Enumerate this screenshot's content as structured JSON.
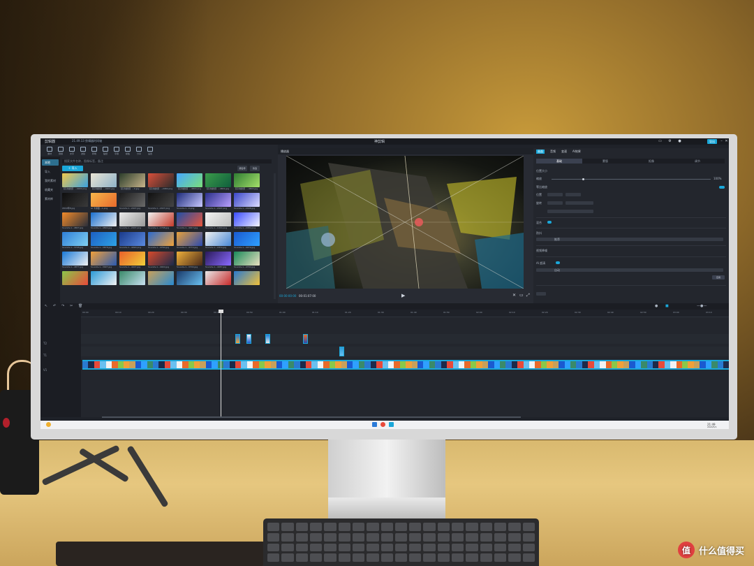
{
  "scene": {
    "watermark": {
      "logo": "值",
      "text": "什么值得买"
    }
  },
  "window": {
    "app_name": "剪辑器",
    "version_label": "21.49.13 剪辑器时间轴",
    "center_title": "神剪辑",
    "export_label": "导出",
    "accent": "#1aa7d9"
  },
  "toolbar": {
    "items": [
      "素材",
      "音频",
      "文字",
      "滤镜",
      "转场",
      "贴纸",
      "字幕",
      "模板",
      "分享",
      "设置"
    ]
  },
  "sidenav": {
    "items": [
      "本地",
      "导入",
      "我的素材",
      "收藏夹",
      "素材库"
    ]
  },
  "media": {
    "search_placeholder": "搜索文件名称，图像标签，备注",
    "import_label": "导入",
    "sort_labels": [
      "按名称",
      "筛选"
    ],
    "items": [
      {
        "caption": "【高清壁纸】...0900.png",
        "color": "linear-gradient(135deg,#f2c94c,#3aa1e0)"
      },
      {
        "caption": "【高清壁纸】...0901.jpg",
        "color": "linear-gradient(135deg,#e9e4d4,#8fb3c9)"
      },
      {
        "caption": "【高清壁纸】...0.jpg",
        "color": "linear-gradient(135deg,#2a3c2a,#c7b48a)"
      },
      {
        "caption": "【高清壁纸】...2480.png",
        "color": "linear-gradient(135deg,#d94f3a,#2b2b2b)"
      },
      {
        "caption": "【高清壁纸】...4800.png",
        "color": "linear-gradient(135deg,#46a7ff,#7adf7a)"
      },
      {
        "caption": "【高清壁纸】...4801.jpg",
        "color": "linear-gradient(135deg,#3b9b4a,#0f5e3d)"
      },
      {
        "caption": "【高清壁纸】...4800.jpg",
        "color": "linear-gradient(135deg,#2f7d32,#a5e06a)"
      },
      {
        "caption": "2019年8.jpg",
        "color": "linear-gradient(135deg,#0e0e0e,#3a3a3a)"
      },
      {
        "caption": "AI 卡通图...1.png",
        "color": "linear-gradient(135deg,#f5b64a,#e86a2c)"
      },
      {
        "caption": "Sounds-1...2407.jpg",
        "color": "linear-gradient(135deg,#1a1a1a,#6a6a6a)"
      },
      {
        "caption": "Sounds-1...2407.png",
        "color": "linear-gradient(135deg,#111,#444)"
      },
      {
        "caption": "Sounds-1...0.png",
        "color": "linear-gradient(135deg,#1d2b7a,#c8c8ff)"
      },
      {
        "caption": "Sounds-1...2407.png",
        "color": "linear-gradient(135deg,#2a2f8a,#b9a0ff)"
      },
      {
        "caption": "Sounds-1...2408.jpg",
        "color": "linear-gradient(135deg,#3a46c8,#dcdcff)"
      },
      {
        "caption": "Sounds-1...4827.jpg",
        "color": "linear-gradient(135deg,#f28b2a,#2b2f3a)"
      },
      {
        "caption": "Sounds-1...4890.jpg",
        "color": "linear-gradient(135deg,#1a6fcf,#f2f2f2)"
      },
      {
        "caption": "Sounds-1...2407.png",
        "color": "linear-gradient(135deg,#eaeaea,#9a9a9a)"
      },
      {
        "caption": "Sounds-1...1798.jpg",
        "color": "linear-gradient(135deg,#f0f0f0,#c43a2a)"
      },
      {
        "caption": "Sounds-1...4917.jpg",
        "color": "linear-gradient(135deg,#1e4fa8,#e8553a)"
      },
      {
        "caption": "Sounds-1...1000.png",
        "color": "linear-gradient(135deg,#f2f2f2,#bfbfbf)"
      },
      {
        "caption": "Sounds-1...2480.png",
        "color": "linear-gradient(135deg,#3a4cff,#f4f4ff)"
      },
      {
        "caption": "Sounds-1...3748.jpg",
        "color": "linear-gradient(135deg,#2f7fd8,#7fd0f2)"
      },
      {
        "caption": "Sounds-1...3878.jpg",
        "color": "linear-gradient(135deg,#1d5fc2,#2ea3e6)"
      },
      {
        "caption": "Sounds-1...4090.png",
        "color": "linear-gradient(135deg,#1a3a8a,#5a8ae0)"
      },
      {
        "caption": "Sounds-1...4760.jpg",
        "color": "linear-gradient(135deg,#2a6ad0,#f0a23a)"
      },
      {
        "caption": "Sounds-1...4770.jpg",
        "color": "linear-gradient(135deg,#e8a03a,#2a4ab0)"
      },
      {
        "caption": "Sounds-1...1879.jpg",
        "color": "linear-gradient(135deg,#f0f0f0,#4a8ad8)"
      },
      {
        "caption": "Sounds-1...4079.jpg",
        "color": "linear-gradient(135deg,#1a5ad0,#2fa0ff)"
      },
      {
        "caption": "Sounds-1...4877.jpg",
        "color": "linear-gradient(135deg,#1a7ad8,#f2f2f2)"
      },
      {
        "caption": "Sounds-1...3997.jpg",
        "color": "linear-gradient(135deg,#f2a03a,#2a5ab0)"
      },
      {
        "caption": "Sounds-1...4407.jpg",
        "color": "linear-gradient(135deg,#e8602a,#f2d03a)"
      },
      {
        "caption": "Sounds-1...4040.jpg",
        "color": "linear-gradient(135deg,#d84a2a,#1a2a4a)"
      },
      {
        "caption": "Sounds-1...3700.jpg",
        "color": "linear-gradient(135deg,#f0b03a,#4a2a1a)"
      },
      {
        "caption": "Sounds-1...4087.jpg",
        "color": "linear-gradient(135deg,#2a1a5a,#8a6aff)"
      },
      {
        "caption": "Sounds-1...4790.jpg",
        "color": "linear-gradient(135deg,#1a8a5a,#e8e0c0)"
      },
      {
        "caption": "",
        "color": "linear-gradient(135deg,#8ac84a,#e84a3a)"
      },
      {
        "caption": "",
        "color": "linear-gradient(135deg,#2a9ad8,#f2f2f2)"
      },
      {
        "caption": "",
        "color": "linear-gradient(135deg,#3a8a6a,#c8e0f0)"
      },
      {
        "caption": "",
        "color": "linear-gradient(135deg,#c8a05a,#2a8ad0)"
      },
      {
        "caption": "",
        "color": "linear-gradient(135deg,#1a3a6a,#6ac0f0)"
      },
      {
        "caption": "",
        "color": "linear-gradient(135deg,#e8e8e8,#c82a2a)"
      },
      {
        "caption": "",
        "color": "linear-gradient(135deg,#2a7ad0,#f0c03a)"
      }
    ]
  },
  "preview": {
    "header": "播放器",
    "timecode": "00:00:00:00",
    "duration": "00:01:07:00"
  },
  "properties": {
    "tabs": [
      "画面",
      "音频",
      "变速",
      "AI效果"
    ],
    "subtabs": [
      "基础",
      "蒙版",
      "抠像",
      "调节"
    ],
    "rows": {
      "position": "位置大小",
      "scale": "缩放",
      "scale_value": "100%",
      "lock_ratio": "等比缩放",
      "pos_label": "位置",
      "rotate_label": "旋转",
      "blend": "混合",
      "stabilize": "防抖",
      "stabilize_option": "推荐",
      "denoise": "视频降噪",
      "ai_enhance": "AI 超清",
      "ai_option": "自动",
      "apply_label": "应用"
    }
  },
  "timeline": {
    "ruler_ticks": [
      "00:00",
      "00:10",
      "00:20",
      "00:30",
      "00:40",
      "00:50",
      "01:00",
      "01:10",
      "01:20",
      "01:30",
      "01:40",
      "01:50",
      "02:00",
      "02:10",
      "02:20",
      "02:30",
      "02:40",
      "02:50",
      "03:00",
      "03:10"
    ],
    "track_labels": [
      "T2",
      "T1",
      "V1"
    ]
  },
  "taskbar": {
    "time": "21:49",
    "date": "2024/5/1"
  }
}
